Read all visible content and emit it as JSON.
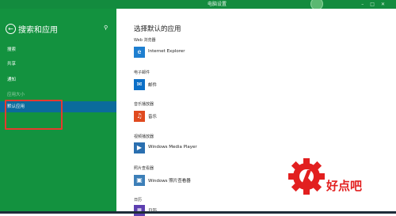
{
  "window": {
    "title": "电脑设置"
  },
  "left_pane": {
    "title": "搜索和应用",
    "items": [
      {
        "label": "搜索",
        "selected": false
      },
      {
        "label": "共享",
        "selected": false
      },
      {
        "label": "通知",
        "selected": false
      },
      {
        "label": "应用大小",
        "selected": false
      },
      {
        "label": "默认应用",
        "selected": true
      }
    ]
  },
  "main": {
    "title": "选择默认的应用",
    "sections": [
      {
        "label": "Web 浏览器",
        "app": "Internet Explorer",
        "icon": "internet-explorer-icon",
        "icon_color": "#1e7fd0"
      },
      {
        "label": "电子邮件",
        "app": "邮件",
        "icon": "mail-icon",
        "icon_color": "#0b6fc7"
      },
      {
        "label": "音乐播放器",
        "app": "音乐",
        "icon": "music-icon",
        "icon_color": "#e04a1f"
      },
      {
        "label": "视频播放器",
        "app": "Windows Media Player",
        "icon": "media-player-icon",
        "icon_color": "#2a6fb0"
      },
      {
        "label": "照片查看器",
        "app": "Windows 照片查看器",
        "icon": "photo-viewer-icon",
        "icon_color": "#3d7fb8"
      },
      {
        "label": "日历",
        "app": "日历",
        "icon": "calendar-icon",
        "icon_color": "#5d3fb0"
      }
    ]
  },
  "watermark": {
    "text": "好点吧",
    "color": "#e21f1f"
  },
  "colors": {
    "accent": "#13923f",
    "selected": "#0b6b9c",
    "highlight_box": "#e53a2e"
  }
}
